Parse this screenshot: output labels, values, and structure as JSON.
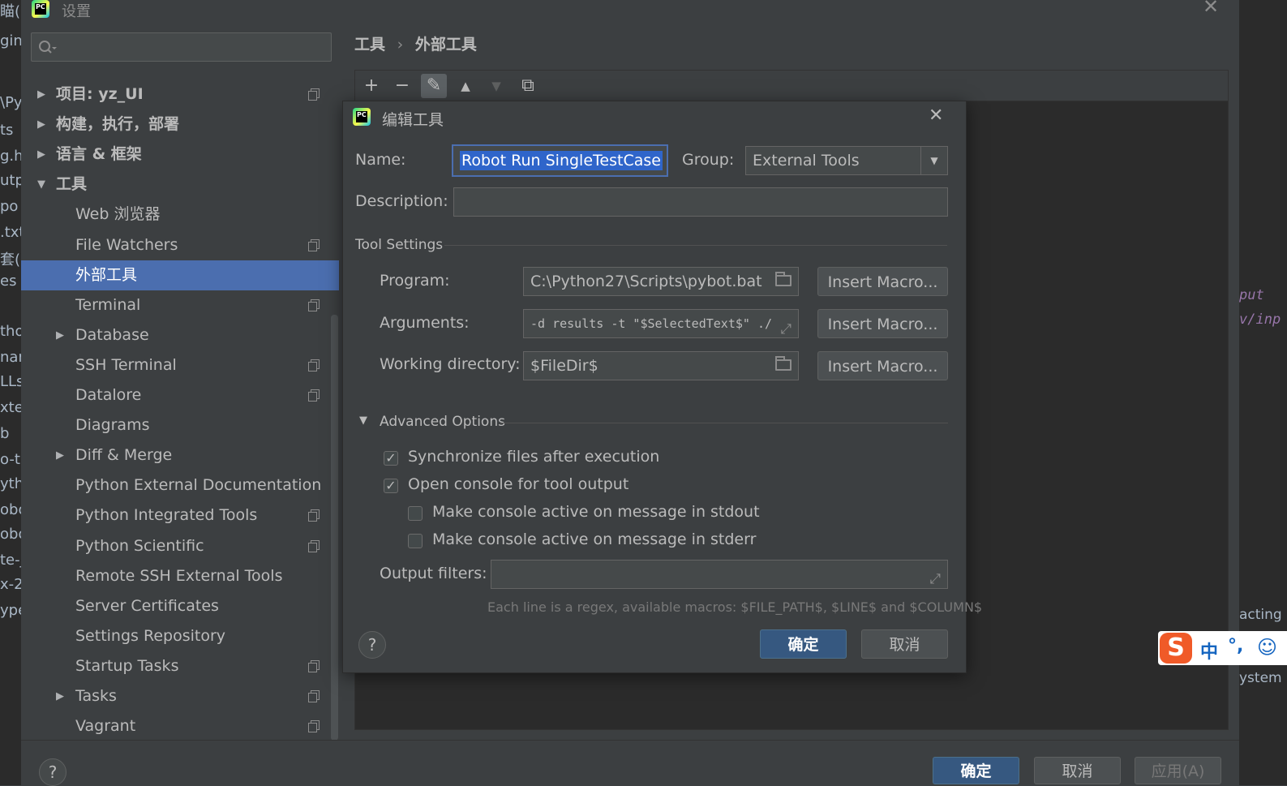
{
  "background": {
    "left_fragments": [
      "瞄(E",
      "gin.t",
      "\\Py",
      "ts",
      "g.h",
      "utp",
      "po",
      ".txt",
      "套(",
      "es a",
      "tho",
      "nar",
      "LLs",
      "xter",
      "b",
      "o-tl",
      "ytho",
      "obo",
      "obo",
      "te-j",
      "x-2",
      "ype"
    ],
    "right_fragments": [
      "put",
      "v/inp",
      "acting",
      "ystem"
    ]
  },
  "settings": {
    "title": "设置",
    "search": {
      "placeholder": "",
      "value": ""
    },
    "tree": [
      {
        "label": "项目: yz_UI",
        "expand": "collapsed",
        "indent": 1,
        "copy": true,
        "bold": true
      },
      {
        "label": "构建，执行，部署",
        "expand": "collapsed",
        "indent": 1,
        "copy": false,
        "bold": true
      },
      {
        "label": "语言 & 框架",
        "expand": "collapsed",
        "indent": 1,
        "copy": false,
        "bold": true
      },
      {
        "label": "工具",
        "expand": "expanded",
        "indent": 1,
        "copy": false,
        "bold": true
      },
      {
        "label": "Web 浏览器",
        "expand": "none",
        "indent": 2,
        "copy": false
      },
      {
        "label": "File Watchers",
        "expand": "none",
        "indent": 2,
        "copy": true
      },
      {
        "label": "外部工具",
        "expand": "none",
        "indent": 2,
        "copy": false,
        "selected": true
      },
      {
        "label": "Terminal",
        "expand": "none",
        "indent": 2,
        "copy": true
      },
      {
        "label": "Database",
        "expand": "collapsed",
        "indent": 2,
        "copy": false
      },
      {
        "label": "SSH Terminal",
        "expand": "none",
        "indent": 2,
        "copy": true
      },
      {
        "label": "Datalore",
        "expand": "none",
        "indent": 2,
        "copy": true
      },
      {
        "label": "Diagrams",
        "expand": "none",
        "indent": 2,
        "copy": false
      },
      {
        "label": "Diff & Merge",
        "expand": "collapsed",
        "indent": 2,
        "copy": false
      },
      {
        "label": "Python External Documentation",
        "expand": "none",
        "indent": 2,
        "copy": false
      },
      {
        "label": "Python Integrated Tools",
        "expand": "none",
        "indent": 2,
        "copy": true
      },
      {
        "label": "Python Scientific",
        "expand": "none",
        "indent": 2,
        "copy": true
      },
      {
        "label": "Remote SSH External Tools",
        "expand": "none",
        "indent": 2,
        "copy": false
      },
      {
        "label": "Server Certificates",
        "expand": "none",
        "indent": 2,
        "copy": false
      },
      {
        "label": "Settings Repository",
        "expand": "none",
        "indent": 2,
        "copy": false
      },
      {
        "label": "Startup Tasks",
        "expand": "none",
        "indent": 2,
        "copy": true
      },
      {
        "label": "Tasks",
        "expand": "collapsed",
        "indent": 2,
        "copy": true
      },
      {
        "label": "Vagrant",
        "expand": "none",
        "indent": 2,
        "copy": true
      }
    ],
    "breadcrumb": {
      "parent": "工具",
      "separator": "›",
      "current": "外部工具"
    },
    "toolbar": {
      "add": "+",
      "remove": "−",
      "edit": "✎",
      "up": "▲",
      "down": "▼",
      "copy": "⧉"
    },
    "bottom": {
      "help": "?",
      "ok": "确定",
      "cancel": "取消",
      "apply": "应用(A)"
    }
  },
  "dialog": {
    "title": "编辑工具",
    "close": "✕",
    "name_label": "Name:",
    "name_value": "Robot Run SingleTestCase",
    "group_label": "Group:",
    "group_value": "External Tools",
    "description_label": "Description:",
    "description_value": "",
    "tool_settings": "Tool Settings",
    "program_label": "Program:",
    "program_value": "C:\\Python27\\Scripts\\pybot.bat",
    "arguments_label": "Arguments:",
    "arguments_value": "-d results -t \"$SelectedText$\" ./",
    "workdir_label": "Working directory:",
    "workdir_value": "$FileDir$",
    "insert_macro": "Insert Macro...",
    "advanced": "Advanced Options",
    "checkboxes": [
      {
        "label": "Synchronize files after execution",
        "checked": true,
        "indent": 0
      },
      {
        "label": "Open console for tool output",
        "checked": true,
        "indent": 0
      },
      {
        "label": "Make console active on message in stdout",
        "checked": false,
        "indent": 1
      },
      {
        "label": "Make console active on message in stderr",
        "checked": false,
        "indent": 1
      }
    ],
    "output_filters_label": "Output filters:",
    "output_filters_value": "",
    "hint": "Each line is a regex, available macros: $FILE_PATH$, $LINE$ and $COLUMN$",
    "help": "?",
    "ok": "确定",
    "cancel": "取消"
  },
  "ime": {
    "logo": "S",
    "mode": "中",
    "punct": "°,",
    "emoji": "☺"
  },
  "colors": {
    "selection": "#4b6eaf",
    "primary_button": "#365880",
    "text": "#bbbbbb",
    "background": "#3c3f41"
  }
}
